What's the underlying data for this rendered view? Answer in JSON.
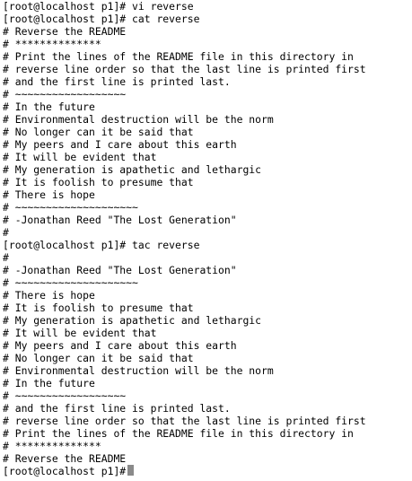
{
  "terminal": {
    "lines": [
      "[root@localhost p1]# vi reverse",
      "[root@localhost p1]# cat reverse",
      "# Reverse the README",
      "# **************",
      "# Print the lines of the README file in this directory in",
      "# reverse line order so that the last line is printed first",
      "# and the first line is printed last.",
      "# ~~~~~~~~~~~~~~~~~~",
      "# In the future",
      "# Environmental destruction will be the norm",
      "# No longer can it be said that",
      "# My peers and I care about this earth",
      "# It will be evident that",
      "# My generation is apathetic and lethargic",
      "# It is foolish to presume that",
      "# There is hope",
      "# ~~~~~~~~~~~~~~~~~~~~",
      "# -Jonathan Reed \"The Lost Generation\"",
      "#",
      "[root@localhost p1]# tac reverse",
      "#",
      "# -Jonathan Reed \"The Lost Generation\"",
      "# ~~~~~~~~~~~~~~~~~~~~",
      "# There is hope",
      "# It is foolish to presume that",
      "# My generation is apathetic and lethargic",
      "# It will be evident that",
      "# My peers and I care about this earth",
      "# No longer can it be said that",
      "# Environmental destruction will be the norm",
      "# In the future",
      "# ~~~~~~~~~~~~~~~~~~",
      "# and the first line is printed last.",
      "# reverse line order so that the last line is printed first",
      "# Print the lines of the README file in this directory in",
      "# **************",
      "# Reverse the README"
    ],
    "prompt": "[root@localhost p1]#"
  }
}
